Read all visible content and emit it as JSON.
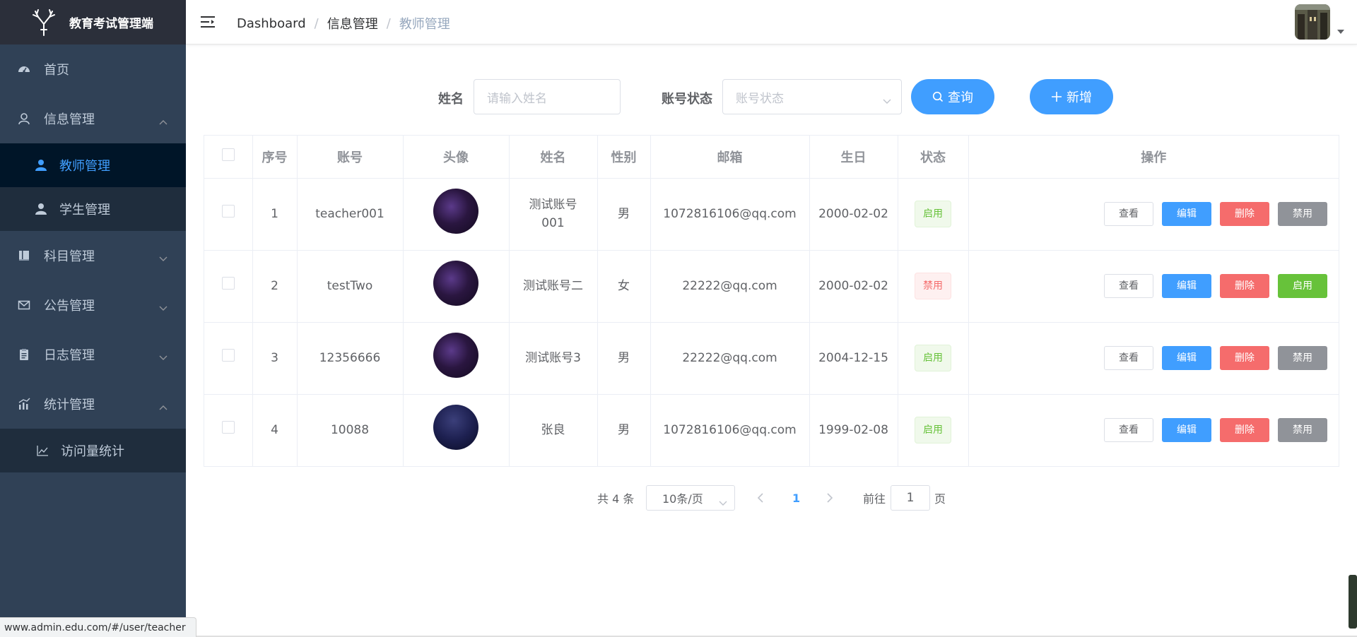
{
  "app": {
    "title": "教育考试管理端"
  },
  "sidebar": {
    "items": [
      {
        "label": "首页",
        "icon": "dashboard-icon"
      },
      {
        "label": "信息管理",
        "icon": "user-icon",
        "expanded": true,
        "children": [
          {
            "label": "教师管理",
            "active": true
          },
          {
            "label": "学生管理"
          }
        ]
      },
      {
        "label": "科目管理",
        "icon": "book-icon"
      },
      {
        "label": "公告管理",
        "icon": "mail-icon"
      },
      {
        "label": "日志管理",
        "icon": "clipboard-icon"
      },
      {
        "label": "统计管理",
        "icon": "chart-icon",
        "expanded": true,
        "children": [
          {
            "label": "访问量统计"
          }
        ]
      }
    ]
  },
  "header": {
    "breadcrumb": [
      "Dashboard",
      "信息管理",
      "教师管理"
    ]
  },
  "search": {
    "name_label": "姓名",
    "name_placeholder": "请输入姓名",
    "status_label": "账号状态",
    "status_placeholder": "账号状态",
    "query_button": "查询",
    "add_button": "新增"
  },
  "table": {
    "columns": [
      "序号",
      "账号",
      "头像",
      "姓名",
      "性别",
      "邮箱",
      "生日",
      "状态",
      "操作"
    ],
    "rows": [
      {
        "index": "1",
        "account": "teacher001",
        "name": "测试账号001",
        "gender": "男",
        "email": "1072816106@qq.com",
        "birthday": "2000-02-02",
        "status": "启用",
        "toggle": "禁用"
      },
      {
        "index": "2",
        "account": "testTwo",
        "name": "测试账号二",
        "gender": "女",
        "email": "22222@qq.com",
        "birthday": "2000-02-02",
        "status": "禁用",
        "toggle": "启用"
      },
      {
        "index": "3",
        "account": "12356666",
        "name": "测试账号3",
        "gender": "男",
        "email": "22222@qq.com",
        "birthday": "2004-12-15",
        "status": "启用",
        "toggle": "禁用"
      },
      {
        "index": "4",
        "account": "10088",
        "name": "张良",
        "gender": "男",
        "email": "1072816106@qq.com",
        "birthday": "1999-02-08",
        "status": "启用",
        "toggle": "禁用"
      }
    ],
    "actions": {
      "view": "查看",
      "edit": "编辑",
      "delete": "删除"
    }
  },
  "pagination": {
    "total": "共 4 条",
    "page_size": "10条/页",
    "current_page": "1",
    "goto_prefix": "前往",
    "goto_value": "1",
    "goto_suffix": "页"
  },
  "statusbar": {
    "url": "www.admin.edu.com/#/user/teacher"
  },
  "colors": {
    "sidebar_bg": "#304156",
    "accent": "#409eff",
    "success": "#67c23a",
    "danger": "#f56c6c",
    "info": "#909399"
  }
}
